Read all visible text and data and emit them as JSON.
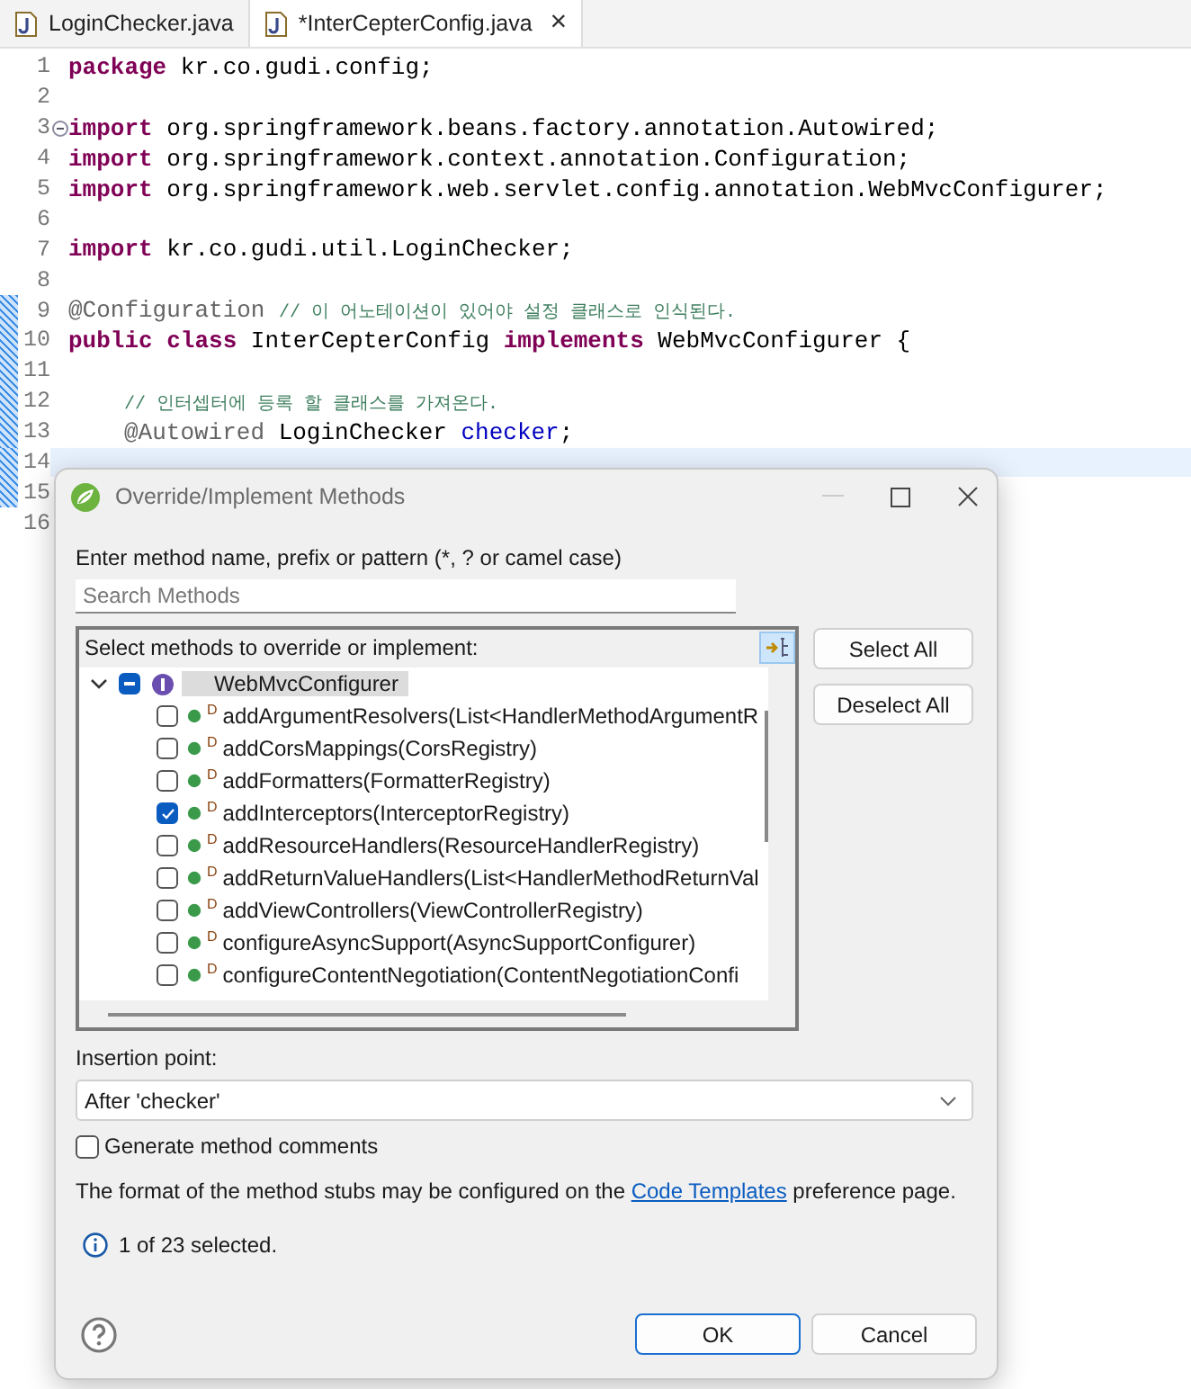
{
  "tabs": [
    {
      "label": "LoginChecker.java",
      "selected": false
    },
    {
      "label": "*InterCepterConfig.java",
      "selected": true,
      "close": "×"
    }
  ],
  "editor": {
    "lines": [
      {
        "n": "1",
        "tokens": [
          {
            "kind": "keyword",
            "text": "package"
          },
          {
            "kind": "plain",
            "text": " kr.co.gudi.config;"
          }
        ]
      },
      {
        "n": "2"
      },
      {
        "n": "3",
        "fold": true,
        "tokens": [
          {
            "kind": "keyword",
            "text": "import"
          },
          {
            "kind": "plain",
            "text": " org.springframework.beans.factory.annotation.Autowired;"
          }
        ]
      },
      {
        "n": "4",
        "tokens": [
          {
            "kind": "keyword",
            "text": "import"
          },
          {
            "kind": "plain",
            "text": " org.springframework.context.annotation.Configuration;"
          }
        ]
      },
      {
        "n": "5",
        "tokens": [
          {
            "kind": "keyword",
            "text": "import"
          },
          {
            "kind": "plain",
            "text": " org.springframework.web.servlet.config.annotation.WebMvcConfigurer;"
          }
        ]
      },
      {
        "n": "6"
      },
      {
        "n": "7",
        "tokens": [
          {
            "kind": "keyword",
            "text": "import"
          },
          {
            "kind": "plain",
            "text": " kr.co.gudi.util.LoginChecker;"
          }
        ]
      },
      {
        "n": "8"
      },
      {
        "n": "9",
        "changed": true,
        "tokens": [
          {
            "kind": "annotation",
            "text": "@Configuration "
          },
          {
            "kind": "comment",
            "text": "// 이 어노테이션이 있어야 설정 클래스로 인식된다."
          }
        ]
      },
      {
        "n": "10",
        "changed": true,
        "tokens": [
          {
            "kind": "keyword",
            "text": "public class"
          },
          {
            "kind": "plain",
            "text": " InterCepterConfig "
          },
          {
            "kind": "keyword",
            "text": "implements"
          },
          {
            "kind": "plain",
            "text": " WebMvcConfigurer {"
          }
        ]
      },
      {
        "n": "11",
        "changed": true
      },
      {
        "n": "12",
        "changed": true,
        "indented": true,
        "tokens": [
          {
            "kind": "comment",
            "text": "// 인터셉터에 등록 할 클래스를 가져온다."
          }
        ]
      },
      {
        "n": "13",
        "changed": true,
        "indented": true,
        "tokens": [
          {
            "kind": "annotation",
            "text": "@Autowired"
          },
          {
            "kind": "plain",
            "text": " LoginChecker "
          },
          {
            "kind": "field",
            "text": "checker"
          },
          {
            "kind": "plain",
            "text": ";"
          }
        ]
      },
      {
        "n": "14",
        "changed": true,
        "current": true
      },
      {
        "n": "15",
        "changed": true
      },
      {
        "n": "16"
      }
    ]
  },
  "dialog": {
    "title": "Override/Implement Methods",
    "filter_label": "Enter method name, prefix or pattern (*, ? or camel case)",
    "search": {
      "placeholder": "Search Methods"
    },
    "tree_label": "Select methods to override or implement:",
    "root": {
      "label": "WebMvcConfigurer",
      "expanded": true,
      "partial": true,
      "selected": true,
      "children": [
        {
          "label": "addArgumentResolvers(List<HandlerMethodArgumentR",
          "badge": "D",
          "checked": false
        },
        {
          "label": "addCorsMappings(CorsRegistry)",
          "badge": "D",
          "checked": false
        },
        {
          "label": "addFormatters(FormatterRegistry)",
          "badge": "D",
          "checked": false
        },
        {
          "label": "addInterceptors(InterceptorRegistry)",
          "badge": "D",
          "checked": true
        },
        {
          "label": "addResourceHandlers(ResourceHandlerRegistry)",
          "badge": "D",
          "checked": false
        },
        {
          "label": "addReturnValueHandlers(List<HandlerMethodReturnVal",
          "badge": "D",
          "checked": false
        },
        {
          "label": "addViewControllers(ViewControllerRegistry)",
          "badge": "D",
          "checked": false
        },
        {
          "label": "configureAsyncSupport(AsyncSupportConfigurer)",
          "badge": "D",
          "checked": false
        },
        {
          "label": "configureContentNegotiation(ContentNegotiationConfi",
          "badge": "D",
          "checked": false
        }
      ]
    },
    "side_buttons": [
      "Select All",
      "Deselect All"
    ],
    "insertion_label": "Insertion point:",
    "insertion_value": "After 'checker'",
    "comments": {
      "label": "Generate method comments",
      "checked": false
    },
    "note": {
      "before": "The format of the method stubs may be configured on the ",
      "link": "Code Templates",
      "after": " preference page."
    },
    "status": "1 of 23 selected.",
    "buttons": [
      {
        "label": "OK",
        "default": true
      },
      {
        "label": "Cancel",
        "default": false
      }
    ]
  }
}
